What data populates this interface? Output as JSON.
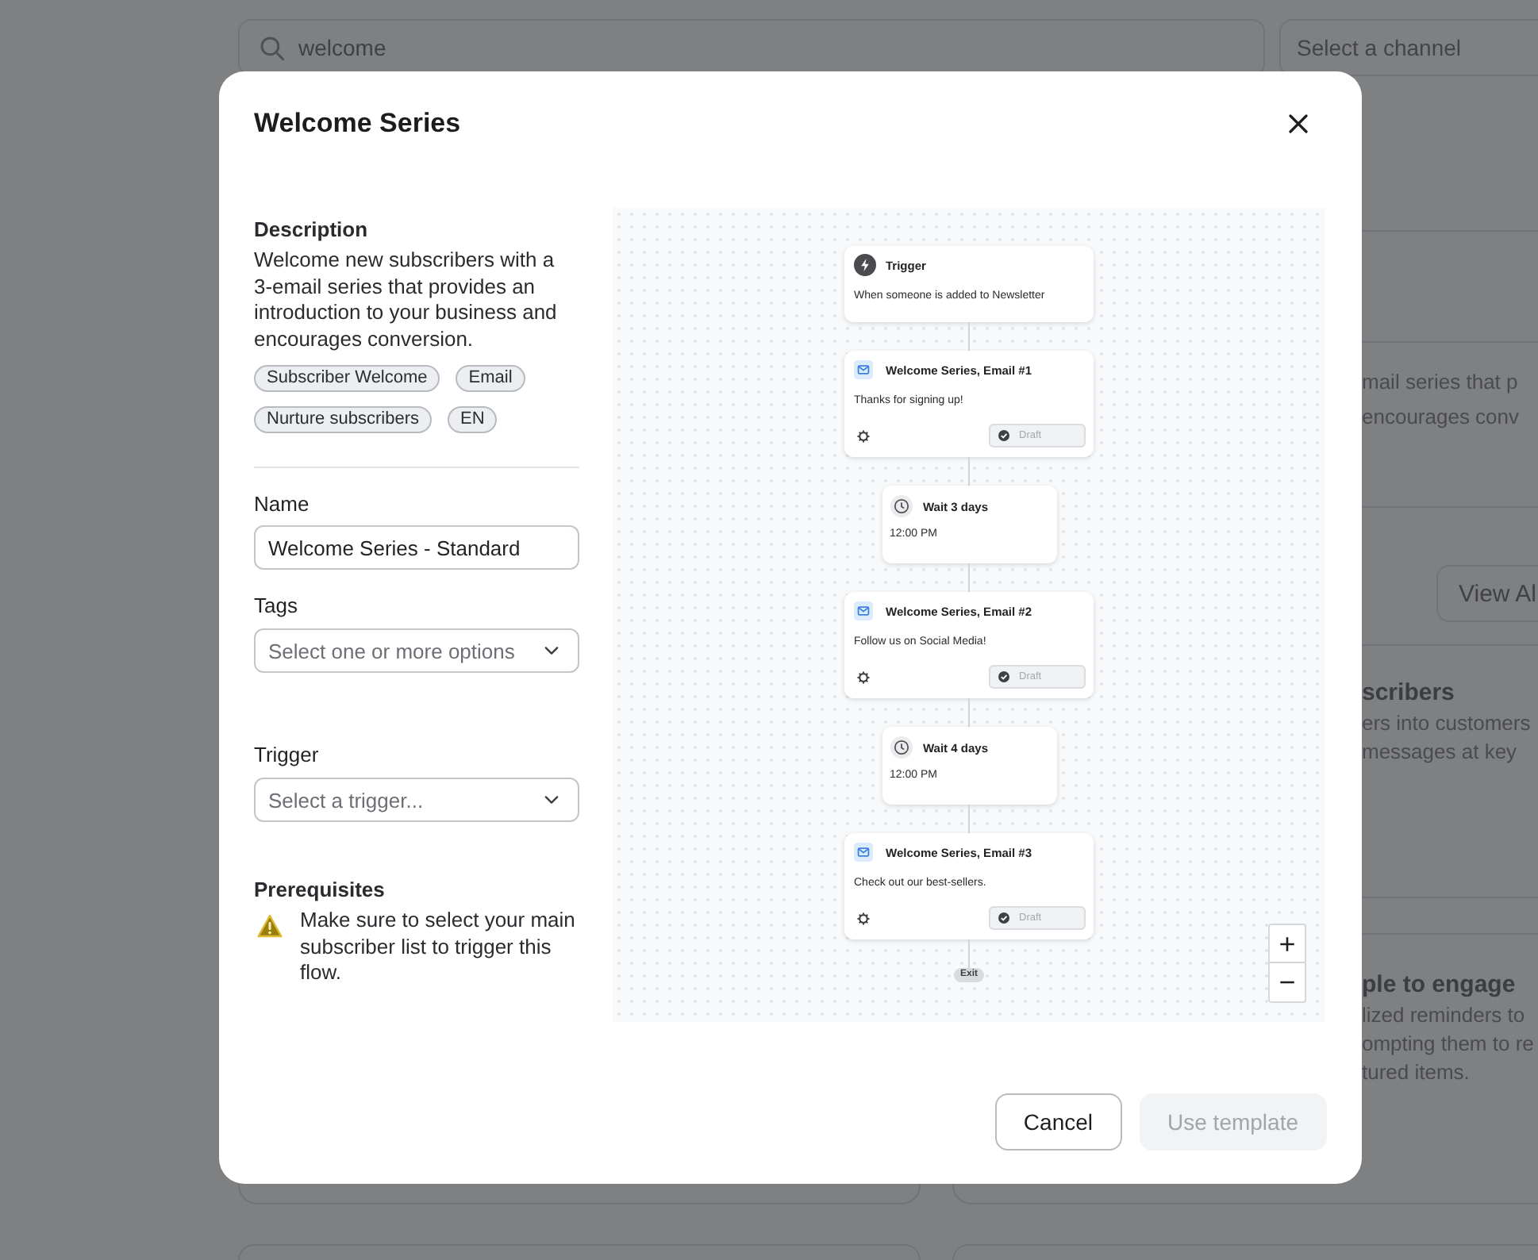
{
  "background": {
    "search_field": {
      "value": "welcome"
    },
    "channel_select": {
      "placeholder": "Select a channel"
    },
    "card": {
      "text_lines": [
        "mail series that p",
        "encourages conv"
      ],
      "button": "View Al",
      "section": {
        "title": "scribers",
        "lines": [
          "ers into customers",
          "messages at key"
        ]
      }
    },
    "next_card": {
      "title": "ple to engage",
      "lines": [
        "lized reminders to",
        "ompting them to re",
        "tured items."
      ]
    }
  },
  "modal": {
    "title": "Welcome Series",
    "description": {
      "label": "Description",
      "text": "Welcome new subscribers with a 3-email series that provides an introduction to your business and encourages conversion."
    },
    "tags": [
      "Subscriber Welcome",
      "Email",
      "Nurture subscribers",
      "EN"
    ],
    "name_field": {
      "label": "Name",
      "value": "Welcome Series - Standard"
    },
    "tags_select": {
      "label": "Tags",
      "placeholder": "Select one or more options"
    },
    "trigger_select": {
      "label": "Trigger",
      "placeholder": "Select a trigger..."
    },
    "prerequisites": {
      "label": "Prerequisites",
      "text": "Make sure to select your main subscriber list to trigger this flow."
    },
    "flow": {
      "nodes": [
        {
          "kind": "trigger",
          "title": "Trigger",
          "text": "When someone is added to Newsletter"
        },
        {
          "kind": "email",
          "title": "Welcome Series, Email #1",
          "text": "Thanks for signing up!",
          "status": "Draft"
        },
        {
          "kind": "wait",
          "title": "Wait 3 days",
          "text": "12:00 PM"
        },
        {
          "kind": "email",
          "title": "Welcome Series, Email #2",
          "text": "Follow us on Social Media!",
          "status": "Draft"
        },
        {
          "kind": "wait",
          "title": "Wait 4 days",
          "text": "12:00 PM"
        },
        {
          "kind": "email",
          "title": "Welcome Series, Email #3",
          "text": "Check out our best-sellers.",
          "status": "Draft"
        }
      ],
      "end": "Exit",
      "zoom_controls": [
        "+",
        "−"
      ]
    },
    "buttons": [
      {
        "label": "Cancel",
        "disabled": false
      },
      {
        "label": "Use template",
        "disabled": true
      }
    ]
  }
}
